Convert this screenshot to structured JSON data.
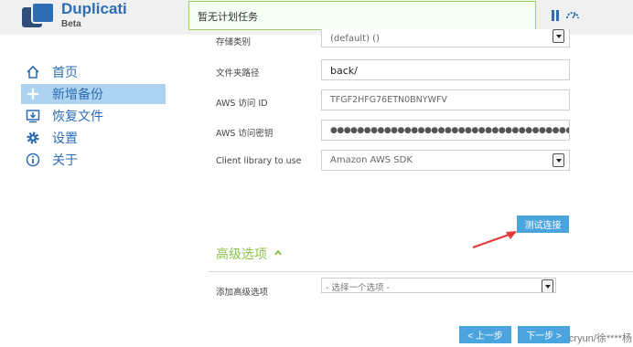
{
  "app": {
    "name": "Duplicati",
    "subtitle": "Beta",
    "status_message": "暂无计划任务"
  },
  "sidebar": {
    "items": [
      {
        "label": "首页",
        "icon": "home-icon",
        "active": false
      },
      {
        "label": "新增备份",
        "icon": "plus-icon",
        "active": true
      },
      {
        "label": "恢复文件",
        "icon": "download-icon",
        "active": false
      },
      {
        "label": "设置",
        "icon": "gear-icon",
        "active": false
      },
      {
        "label": "关于",
        "icon": "info-icon",
        "active": false
      }
    ]
  },
  "form": {
    "storage_class": {
      "label": "存储类别",
      "value": "(default) ()"
    },
    "folder_path": {
      "label": "文件夹路径",
      "value": "back/"
    },
    "aws_id": {
      "label": "AWS 访问 ID",
      "value": "TFGF2HFG76ETN0BNYWFV"
    },
    "aws_key": {
      "label": "AWS 访问密钥",
      "value": "●●●●●●●●●●●●●●●●●●●●●●●●●●●●●●●●●●●●●●●●●●"
    },
    "client_library": {
      "label": "Client library to use",
      "value": "Amazon AWS SDK"
    },
    "test_button": "测试连接"
  },
  "advanced": {
    "title": "高级选项",
    "add_label": "添加高级选项",
    "select_placeholder": "- 选择一个选项 -"
  },
  "navigation": {
    "prev": "< 上一步",
    "next": "下一步 >"
  },
  "watermark": "cryun/徐****杨",
  "colors": {
    "brand": "#2e6db4",
    "accent_green": "#8bc34a",
    "button_blue": "#4aa5de",
    "annotation_red": "#e53935",
    "active_nav": "#aed3f0"
  }
}
